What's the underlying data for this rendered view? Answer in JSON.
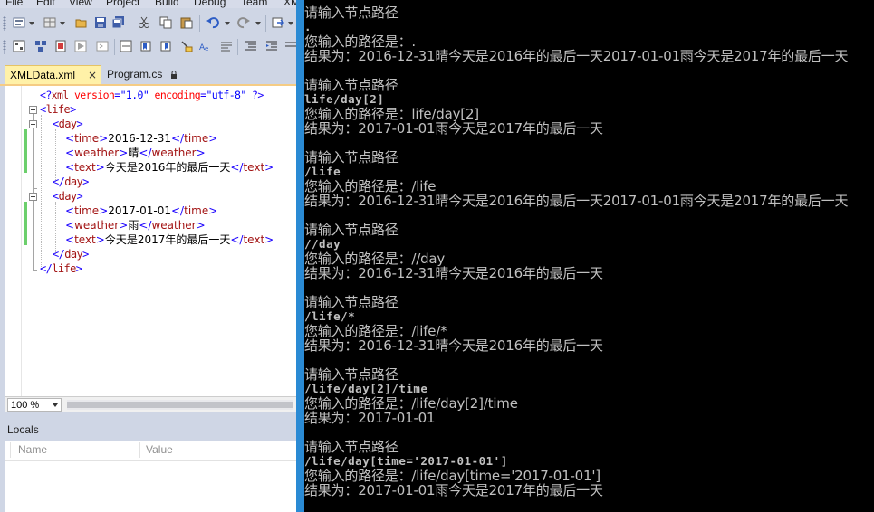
{
  "menu": [
    "File",
    "Edit",
    "View",
    "Project",
    "Build",
    "Debug",
    "Team",
    "XM"
  ],
  "tabs": [
    {
      "label": "XMLData.xml",
      "active": true,
      "close": "×"
    },
    {
      "label": "Program.cs",
      "active": false
    }
  ],
  "editor": {
    "lines": {
      "decl_open": "<?",
      "decl_name": "xml",
      "decl_attr1": "version",
      "decl_eq1": "=",
      "decl_val1": "\"1.0\"",
      "decl_attr2": "encoding",
      "decl_eq2": "=",
      "decl_val2": "\"utf-8\"",
      "decl_close": "?>",
      "life_open": "life",
      "day1_open": "day",
      "time1_value": "2016-12-31",
      "weather1_value": "晴",
      "text1_value": "今天是2016年的最后一天",
      "day2_open": "day",
      "time2_value": "2017-01-01",
      "weather2_value": "雨",
      "text2_value": "今天是2017年的最后一天",
      "tag_time": "time",
      "tag_weather": "weather",
      "tag_text": "text",
      "tag_day": "day",
      "tag_life": "life"
    },
    "zoom": "100 %"
  },
  "locals": {
    "title": "Locals",
    "columns": [
      "Name",
      "Value"
    ]
  },
  "console": {
    "lines": [
      {
        "text": "请输入节点路径",
        "kind": "prompt"
      },
      {
        "text": ".",
        "kind": "input"
      },
      {
        "text": "您输入的路径是：.",
        "kind": "echo"
      },
      {
        "text": "结果为：2016-12-31晴今天是2016年的最后一天2017-01-01雨今天是2017年的最后一天",
        "kind": "result"
      },
      {
        "text": "请输入节点路径",
        "kind": "prompt"
      },
      {
        "text": "life/day[2]",
        "kind": "input"
      },
      {
        "text": "您输入的路径是：life/day[2]",
        "kind": "echo"
      },
      {
        "text": "结果为：2017-01-01雨今天是2017年的最后一天",
        "kind": "result"
      },
      {
        "text": "请输入节点路径",
        "kind": "prompt"
      },
      {
        "text": "/life",
        "kind": "input"
      },
      {
        "text": "您输入的路径是：/life",
        "kind": "echo"
      },
      {
        "text": "结果为：2016-12-31晴今天是2016年的最后一天2017-01-01雨今天是2017年的最后一天",
        "kind": "result"
      },
      {
        "text": "请输入节点路径",
        "kind": "prompt"
      },
      {
        "text": "//day",
        "kind": "input"
      },
      {
        "text": "您输入的路径是：//day",
        "kind": "echo"
      },
      {
        "text": "结果为：2016-12-31晴今天是2016年的最后一天",
        "kind": "result"
      },
      {
        "text": "请输入节点路径",
        "kind": "prompt"
      },
      {
        "text": "/life/*",
        "kind": "input"
      },
      {
        "text": "您输入的路径是：/life/*",
        "kind": "echo"
      },
      {
        "text": "结果为：2016-12-31晴今天是2016年的最后一天",
        "kind": "result"
      },
      {
        "text": "请输入节点路径",
        "kind": "prompt"
      },
      {
        "text": "/life/day[2]/time",
        "kind": "input"
      },
      {
        "text": "您输入的路径是：/life/day[2]/time",
        "kind": "echo"
      },
      {
        "text": "结果为：2017-01-01",
        "kind": "result"
      },
      {
        "text": "请输入节点路径",
        "kind": "prompt"
      },
      {
        "text": "/life/day[time='2017-01-01']",
        "kind": "input"
      },
      {
        "text": "您输入的路径是：/life/day[time='2017-01-01']",
        "kind": "echo"
      },
      {
        "text": "结果为：2017-01-01雨今天是2017年的最后一天",
        "kind": "result"
      }
    ]
  },
  "colors": {
    "splitter": "#2a8ad4",
    "active_tab": "#fff1a8",
    "console_bg": "#000000",
    "console_fg": "#c0c0c0",
    "xml_tag": "#a31515",
    "xml_delim": "#1a00ff",
    "xml_attr": "#ff0000",
    "xml_value": "#0000ff",
    "change_bar": "#6ccf6c"
  },
  "icons": [
    "solution-explorer-icon",
    "dropdown-icon",
    "new-project-icon",
    "open-file-icon",
    "save-icon",
    "save-all-icon",
    "cut-icon",
    "copy-icon",
    "paste-icon",
    "undo-icon",
    "redo-icon",
    "navigate-icon",
    "lock-icon",
    "close-icon"
  ]
}
